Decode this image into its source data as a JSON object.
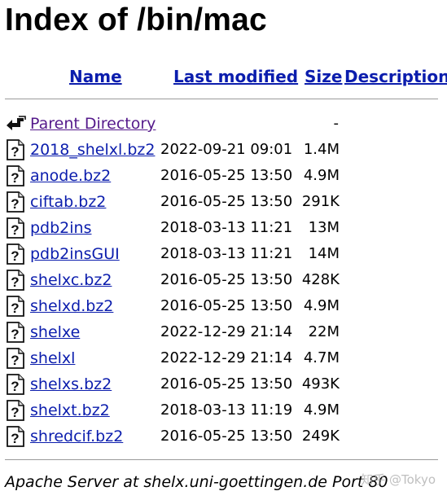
{
  "page": {
    "title": "Index of /bin/mac"
  },
  "table": {
    "headers": {
      "name": "Name",
      "last_modified": "Last modified",
      "size": "Size",
      "description": "Description"
    },
    "parent": {
      "label": "Parent Directory",
      "size": "-",
      "icon": "back-arrow-icon"
    },
    "rows": [
      {
        "name": "2018_shelxl.bz2",
        "modified": "2022-09-21 09:01",
        "size": "1.4M",
        "icon": "unknown-file-icon"
      },
      {
        "name": "anode.bz2",
        "modified": "2016-05-25 13:50",
        "size": "4.9M",
        "icon": "unknown-file-icon"
      },
      {
        "name": "ciftab.bz2",
        "modified": "2016-05-25 13:50",
        "size": "291K",
        "icon": "unknown-file-icon"
      },
      {
        "name": "pdb2ins",
        "modified": "2018-03-13 11:21",
        "size": "13M",
        "icon": "unknown-file-icon"
      },
      {
        "name": "pdb2insGUI",
        "modified": "2018-03-13 11:21",
        "size": "14M",
        "icon": "unknown-file-icon"
      },
      {
        "name": "shelxc.bz2",
        "modified": "2016-05-25 13:50",
        "size": "428K",
        "icon": "unknown-file-icon"
      },
      {
        "name": "shelxd.bz2",
        "modified": "2016-05-25 13:50",
        "size": "4.9M",
        "icon": "unknown-file-icon"
      },
      {
        "name": "shelxe",
        "modified": "2022-12-29 21:14",
        "size": "22M",
        "icon": "unknown-file-icon"
      },
      {
        "name": "shelxl",
        "modified": "2022-12-29 21:14",
        "size": "4.7M",
        "icon": "unknown-file-icon"
      },
      {
        "name": "shelxs.bz2",
        "modified": "2016-05-25 13:50",
        "size": "493K",
        "icon": "unknown-file-icon"
      },
      {
        "name": "shelxt.bz2",
        "modified": "2018-03-13 11:19",
        "size": "4.9M",
        "icon": "unknown-file-icon"
      },
      {
        "name": "shredcif.bz2",
        "modified": "2016-05-25 13:50",
        "size": "249K",
        "icon": "unknown-file-icon"
      }
    ]
  },
  "footer": {
    "text": "Apache Server at shelx.uni-goettingen.de Port 80"
  },
  "watermark": {
    "text": "知乎 @Tokyo"
  },
  "colors": {
    "link": "#0b1dad",
    "visited_link": "#551a8b"
  }
}
